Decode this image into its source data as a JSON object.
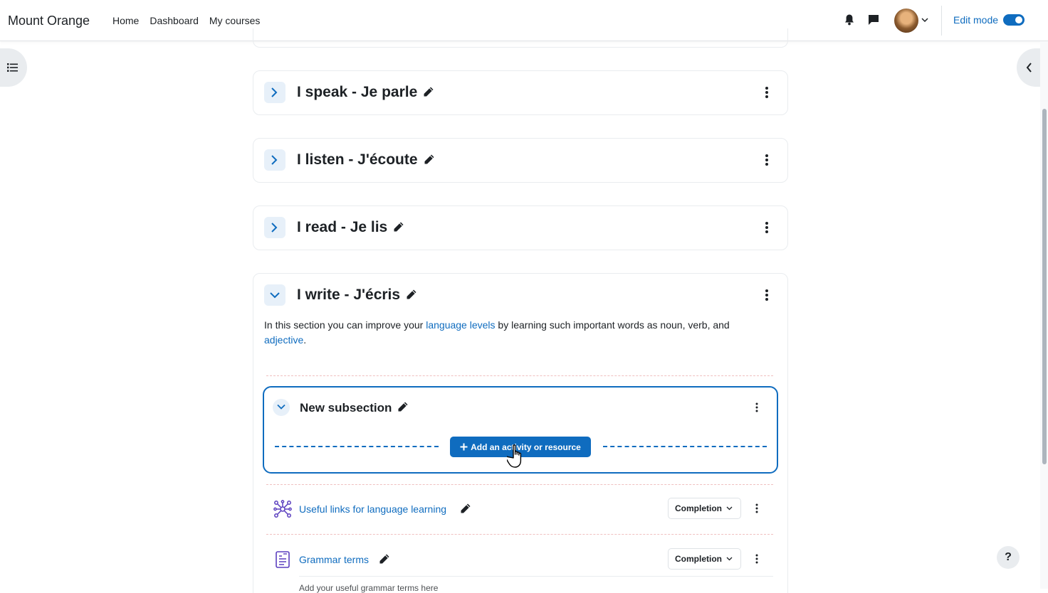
{
  "header": {
    "brand": "Mount Orange",
    "nav": [
      "Home",
      "Dashboard",
      "My courses"
    ],
    "edit_mode_label": "Edit mode",
    "edit_mode_on": true
  },
  "sections": [
    {
      "title": "I speak - Je parle",
      "expanded": false
    },
    {
      "title": "I listen - J'écoute",
      "expanded": false
    },
    {
      "title": "I read - Je lis",
      "expanded": false
    },
    {
      "title": "I write - J'écris",
      "expanded": true,
      "summary": {
        "part1": "In this section you can improve your ",
        "link1": "language levels",
        "part2": " by learning such important words as noun, verb, and ",
        "link2": "adjective",
        "part3": "."
      }
    }
  ],
  "subsection": {
    "title": "New subsection",
    "add_button": "Add an activity or resource"
  },
  "activities": [
    {
      "name": "Useful links for language learning",
      "icon": "network-icon",
      "completion": "Completion"
    },
    {
      "name": "Grammar terms",
      "icon": "glossary-icon",
      "completion": "Completion",
      "description": "Add your useful grammar terms here"
    }
  ],
  "help_label": "?",
  "colors": {
    "primary": "#0f6cbf",
    "section_border": "#e9ecef"
  }
}
